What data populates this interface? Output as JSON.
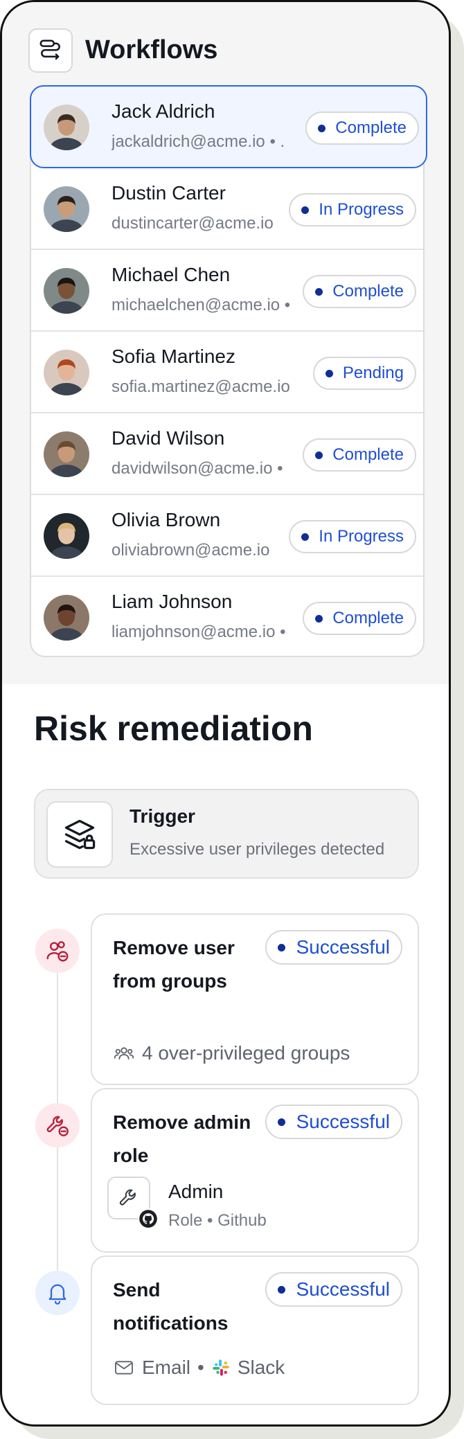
{
  "header": {
    "title": "Workflows"
  },
  "workflows": [
    {
      "name": "Jack Aldrich",
      "email": "jackaldrich@acme.io • .",
      "status": "Complete",
      "skin": "#c69a78",
      "hair": "#3b2a20",
      "bg": "#d6d0c8"
    },
    {
      "name": "Dustin Carter",
      "email": "dustincarter@acme.io",
      "status": "In Progress",
      "skin": "#c89d78",
      "hair": "#2a211b",
      "bg": "#9aa7b0"
    },
    {
      "name": "Michael Chen",
      "email": "michaelchen@acme.io •",
      "status": "Complete",
      "skin": "#7a5238",
      "hair": "#1b1410",
      "bg": "#7f8a88"
    },
    {
      "name": "Sofia Martinez",
      "email": "sofia.martinez@acme.io",
      "status": "Pending",
      "skin": "#e2b59a",
      "hair": "#b2461e",
      "bg": "#d9c8be"
    },
    {
      "name": "David Wilson",
      "email": "davidwilson@acme.io •",
      "status": "Complete",
      "skin": "#c89a7a",
      "hair": "#6a4a30",
      "bg": "#8d7c6c"
    },
    {
      "name": "Olivia Brown",
      "email": "oliviabrown@acme.io",
      "status": "In Progress",
      "skin": "#e6c3a8",
      "hair": "#d9b77a",
      "bg": "#20272d"
    },
    {
      "name": "Liam Johnson",
      "email": "liamjohnson@acme.io •",
      "status": "Complete",
      "skin": "#6e4330",
      "hair": "#1f1510",
      "bg": "#8c7868"
    }
  ],
  "risk": {
    "title": "Risk remediation",
    "trigger": {
      "title": "Trigger",
      "subtitle": "Excessive user privileges detected"
    },
    "steps": {
      "remove_groups": {
        "title": "Remove user from groups",
        "status": "Successful",
        "meta": "4 over-privileged groups"
      },
      "remove_admin": {
        "title": "Remove admin role",
        "status": "Successful",
        "role_name": "Admin",
        "role_sub": "Role • Github"
      },
      "notify": {
        "title": "Send notifications",
        "status": "Successful",
        "email": "Email",
        "sep": "•",
        "slack": "Slack"
      }
    }
  },
  "colors": {
    "accent": "#2b67e8",
    "status_text": "#1f4fd1",
    "status_dot": "#0f2f95",
    "danger_icon": "#b5203a"
  }
}
